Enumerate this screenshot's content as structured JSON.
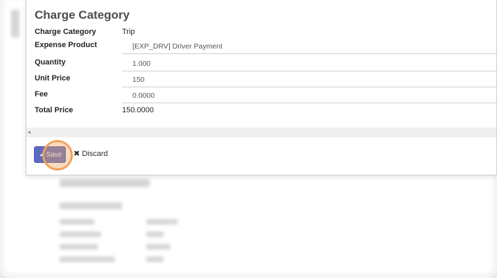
{
  "dialog": {
    "title": "Charge Category",
    "fields": [
      {
        "label": "Charge Category",
        "value": "Trip"
      },
      {
        "label": "Expense Product",
        "value": "[EXP_DRV] Driver Payment"
      },
      {
        "label": "Quantity",
        "value": "1.000"
      },
      {
        "label": "Unit Price",
        "value": "150"
      },
      {
        "label": "Fee",
        "value": "0.0000"
      },
      {
        "label": "Total Price",
        "value": "150.0000"
      }
    ],
    "scroll_arrow": "◂",
    "save_label": "Save",
    "save_icon": "✔",
    "discard_label": "Discard",
    "discard_icon": "✖"
  },
  "colors": {
    "primary": "#5c6bc0",
    "click_highlight": "#f3a15a"
  }
}
